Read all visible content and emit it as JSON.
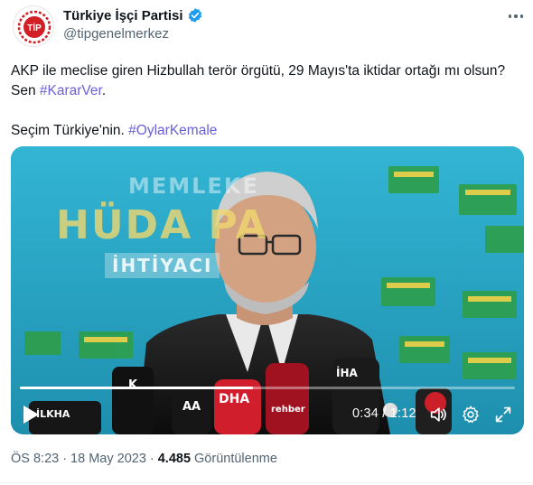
{
  "author": {
    "display_name": "Türkiye İşçi Partisi",
    "handle": "@tipgenelmerkez",
    "avatar_text": "TİP",
    "verified": true
  },
  "tweet": {
    "line1_text": "AKP ile meclise giren Hizbullah terör örgütü, 29 Mayıs'ta iktidar ortağı mı olsun? Sen ",
    "line1_hashtag": "#KararVer",
    "line1_end": ".",
    "line2_text": "Seçim Türkiye'nin. ",
    "line2_hashtag": "#OylarKemale"
  },
  "video": {
    "background_words": [
      "MEMLEKE",
      "HÜDA PA",
      "İHTİYACI"
    ],
    "microphone_labels": [
      "İHA",
      "DHA",
      "İLKHA",
      "rehber"
    ],
    "current_time": "0:34",
    "duration": "1:12",
    "time_display": "0:34 / 1:12",
    "progress_fraction": 0.47
  },
  "meta": {
    "time": "ÖS 8:23",
    "separator": "·",
    "date": "18 May 2023",
    "views_count": "4.485",
    "views_label": "Görüntülenme"
  },
  "colors": {
    "accent_hashtag": "#6b5fd8",
    "secondary_text": "#536471",
    "verified_blue": "#1d9bf0",
    "tip_red": "#d21f26"
  },
  "icons": [
    "verified-icon",
    "more-icon",
    "play-icon",
    "volume-icon",
    "settings-icon",
    "fullscreen-icon"
  ]
}
